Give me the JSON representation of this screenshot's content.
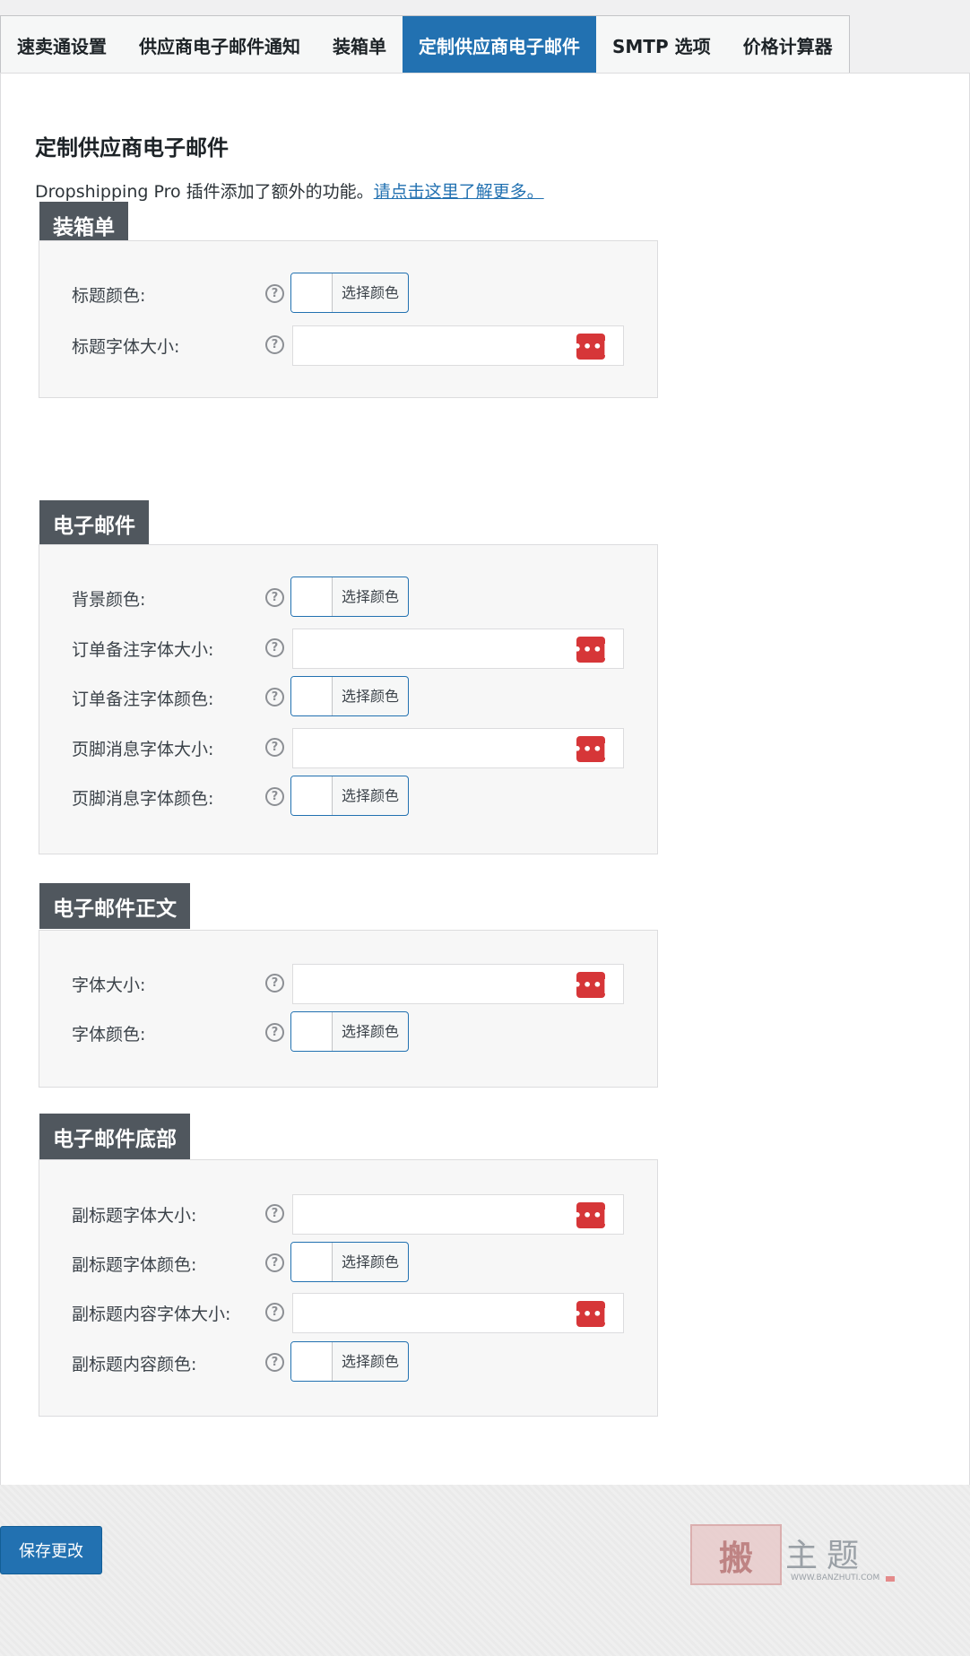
{
  "tabs": [
    {
      "label": "速卖通设置"
    },
    {
      "label": "供应商电子邮件通知"
    },
    {
      "label": "装箱单"
    },
    {
      "label": "定制供应商电子邮件"
    },
    {
      "label": "SMTP 选项"
    },
    {
      "label": "价格计算器"
    }
  ],
  "active_tab": "定制供应商电子邮件",
  "page": {
    "title": "定制供应商电子邮件",
    "intro_text": "Dropshipping Pro 插件添加了额外的功能。",
    "intro_link": "请点击这里了解更多。"
  },
  "sections": [
    {
      "title": "装箱单",
      "rows": [
        {
          "label": "标题颜色:",
          "type": "color",
          "button": "选择颜色"
        },
        {
          "label": "标题字体大小:",
          "type": "number"
        }
      ]
    },
    {
      "title": "电子邮件",
      "rows": [
        {
          "label": "背景颜色:",
          "type": "color",
          "button": "选择颜色"
        },
        {
          "label": "订单备注字体大小:",
          "type": "number"
        },
        {
          "label": "订单备注字体颜色:",
          "type": "color",
          "button": "选择颜色"
        },
        {
          "label": "页脚消息字体大小:",
          "type": "number"
        },
        {
          "label": "页脚消息字体颜色:",
          "type": "color",
          "button": "选择颜色"
        }
      ]
    },
    {
      "title": "电子邮件正文",
      "rows": [
        {
          "label": "字体大小:",
          "type": "number"
        },
        {
          "label": "字体颜色:",
          "type": "color",
          "button": "选择颜色"
        }
      ]
    },
    {
      "title": "电子邮件底部",
      "rows": [
        {
          "label": "副标题字体大小:",
          "type": "number"
        },
        {
          "label": "副标题字体颜色:",
          "type": "color",
          "button": "选择颜色"
        },
        {
          "label": "副标题内容字体大小:",
          "type": "number"
        },
        {
          "label": "副标题内容颜色:",
          "type": "color",
          "button": "选择颜色"
        }
      ]
    }
  ],
  "help_icon_glyph": "?",
  "number_input_glyph": "•••|",
  "save_button": "保存更改",
  "watermark": {
    "stamp": "搬",
    "text": "主题",
    "url": "WWW.BANZHUTI.COM"
  },
  "colors": {
    "accent": "#2271b1",
    "section_header_bg": "#50575e",
    "number_icon": "#d63638"
  }
}
